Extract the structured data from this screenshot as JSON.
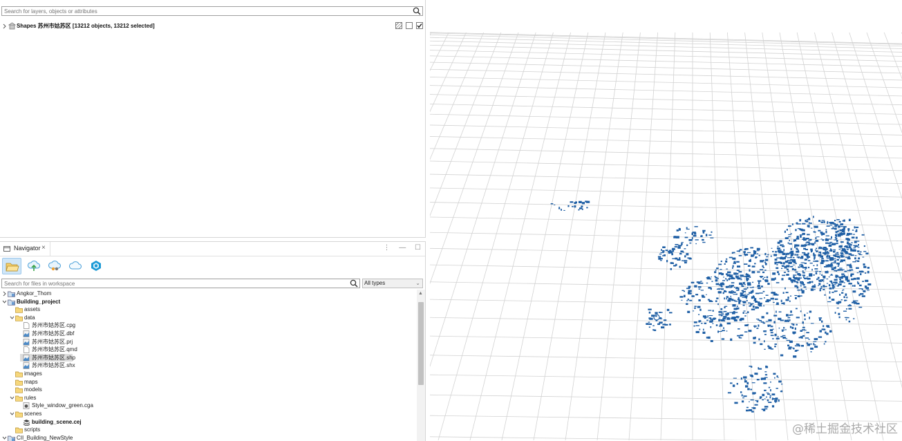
{
  "scene": {
    "search": {
      "placeholder": "Search for layers, objects or attributes"
    },
    "layer": {
      "name": "Shapes 苏州市姑苏区 [13212 objects, 13212 selected]",
      "visible": true
    }
  },
  "navigator": {
    "tab_label": "Navigator",
    "tab_close": "×",
    "toolbar_icons": [
      "open-folder-icon",
      "cloud-upload-icon",
      "cloud-share-icon",
      "cloud-icon",
      "arcgis-icon"
    ],
    "search": {
      "placeholder": "Search for files in workspace"
    },
    "type_filter": "All types",
    "tree": [
      {
        "label": "Angkor_Thom",
        "level": 0,
        "kind": "project",
        "expanded": false,
        "bold": false
      },
      {
        "label": "Building_project",
        "level": 0,
        "kind": "project",
        "expanded": true,
        "bold": true
      },
      {
        "label": "assets",
        "level": 1,
        "kind": "folder",
        "expanded": null,
        "bold": false
      },
      {
        "label": "data",
        "level": 1,
        "kind": "folder",
        "expanded": true,
        "bold": false
      },
      {
        "label": "苏州市姑苏区.cpg",
        "level": 2,
        "kind": "file",
        "bold": false
      },
      {
        "label": "苏州市姑苏区.dbf",
        "level": 2,
        "kind": "gis-file",
        "bold": false
      },
      {
        "label": "苏州市姑苏区.prj",
        "level": 2,
        "kind": "gis-file",
        "bold": false
      },
      {
        "label": "苏州市姑苏区.qmd",
        "level": 2,
        "kind": "file",
        "bold": false
      },
      {
        "label": "苏州市姑苏区.shp",
        "level": 2,
        "kind": "gis-file",
        "bold": false,
        "selected": true
      },
      {
        "label": "苏州市姑苏区.shx",
        "level": 2,
        "kind": "gis-file",
        "bold": false
      },
      {
        "label": "images",
        "level": 1,
        "kind": "folder",
        "expanded": null,
        "bold": false
      },
      {
        "label": "maps",
        "level": 1,
        "kind": "folder",
        "expanded": null,
        "bold": false
      },
      {
        "label": "models",
        "level": 1,
        "kind": "folder",
        "expanded": null,
        "bold": false
      },
      {
        "label": "rules",
        "level": 1,
        "kind": "folder",
        "expanded": true,
        "bold": false
      },
      {
        "label": "Style_window_green.cga",
        "level": 2,
        "kind": "cga-file",
        "bold": false
      },
      {
        "label": "scenes",
        "level": 1,
        "kind": "folder",
        "expanded": true,
        "bold": false
      },
      {
        "label": "building_scene.cej",
        "level": 2,
        "kind": "scene-file",
        "bold": true
      },
      {
        "label": "scripts",
        "level": 1,
        "kind": "folder",
        "expanded": null,
        "bold": false
      },
      {
        "label": "CII_Building_NewStyle",
        "level": 0,
        "kind": "project",
        "expanded": true,
        "bold": false
      }
    ]
  },
  "viewport": {
    "watermark": "@稀土掘金技术社区",
    "grid_color": "#d2d2d2",
    "building_color": "#1f5fa5"
  }
}
